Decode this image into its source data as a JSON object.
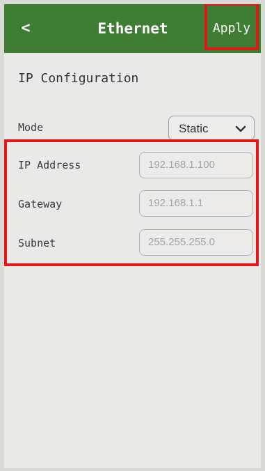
{
  "header": {
    "back_label": "<",
    "title": "Ethernet",
    "apply_label": "Apply"
  },
  "section": {
    "title": "IP Configuration"
  },
  "mode": {
    "label": "Mode",
    "selected": "Static"
  },
  "fields": [
    {
      "label": "IP Address",
      "value": "192.168.1.100"
    },
    {
      "label": "Gateway",
      "value": "192.168.1.1"
    },
    {
      "label": "Subnet",
      "value": "255.255.255.0"
    }
  ],
  "colors": {
    "topbar": "#3f7d34",
    "highlight": "#e01818",
    "background": "#e9e9e7"
  }
}
